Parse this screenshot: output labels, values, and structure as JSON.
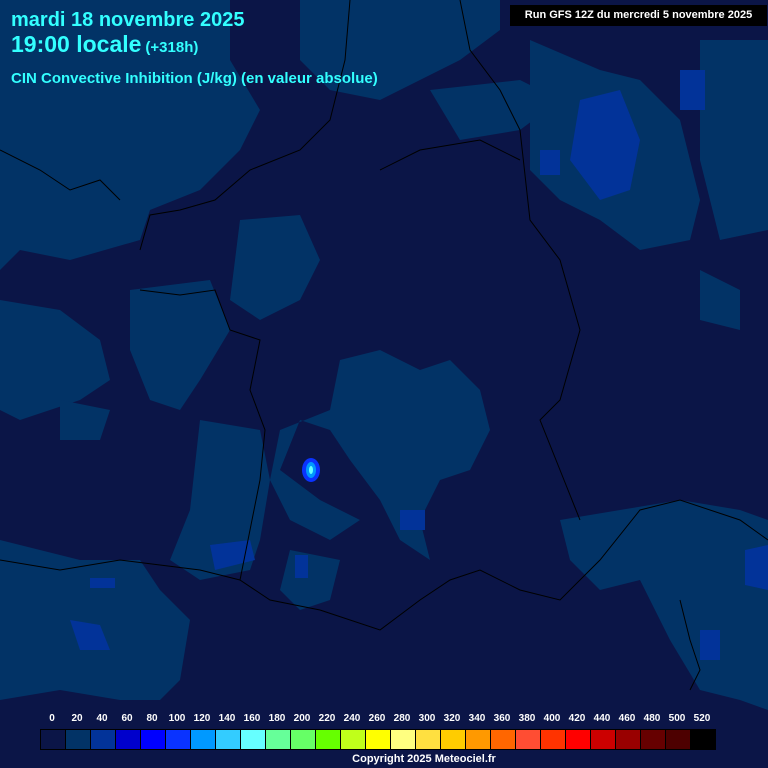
{
  "header": {
    "date": "mardi 18 novembre 2025",
    "time": "19:00 locale",
    "lead": "(+318h)",
    "parameter": "CIN Convective Inhibition (J/kg) (en valeur absolue)"
  },
  "run_info": "Run GFS 12Z du mercredi 5 novembre 2025",
  "legend": {
    "labels": [
      "0",
      "20",
      "40",
      "60",
      "80",
      "100",
      "120",
      "140",
      "160",
      "180",
      "200",
      "220",
      "240",
      "260",
      "280",
      "300",
      "320",
      "340",
      "360",
      "380",
      "400",
      "420",
      "440",
      "460",
      "480",
      "500",
      "520"
    ],
    "colors": [
      "#0b1547",
      "#023366",
      "#023399",
      "#0000cc",
      "#0000ff",
      "#0a33ff",
      "#0099ff",
      "#33ccff",
      "#66ffff",
      "#66ff99",
      "#66ff66",
      "#66ff00",
      "#c0ff1a",
      "#ffff00",
      "#ffff80",
      "#ffe040",
      "#ffcc00",
      "#ff9900",
      "#ff6600",
      "#ff4d33",
      "#ff3300",
      "#ff0000",
      "#cc0000",
      "#990000",
      "#660000",
      "#4d0000",
      "#000000"
    ]
  },
  "copyright": "Copyright 2025 Meteociel.fr"
}
